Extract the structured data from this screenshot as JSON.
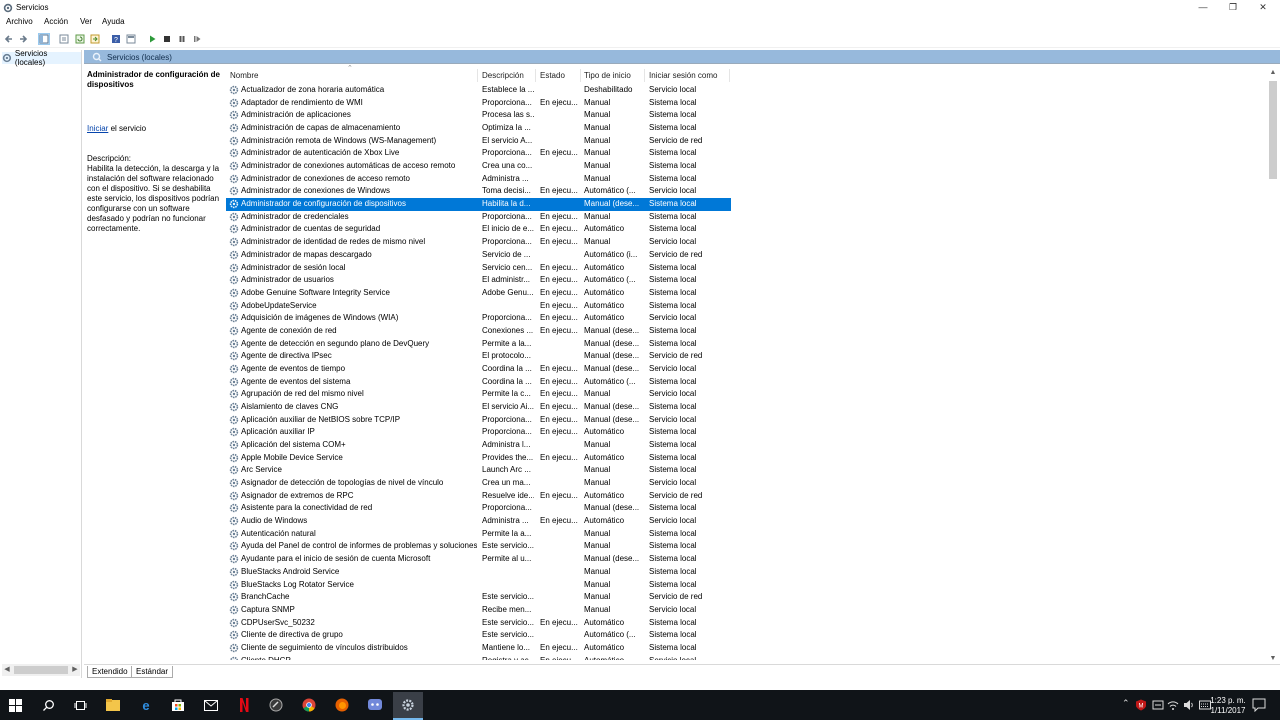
{
  "window": {
    "title": "Servicios",
    "minimize_glyph": "—",
    "restore_glyph": "❐",
    "close_glyph": "✕"
  },
  "menu": [
    "Archivo",
    "Acción",
    "Ver",
    "Ayuda"
  ],
  "tree": {
    "item": "Servicios (locales)"
  },
  "header": {
    "title": "Servicios (locales)"
  },
  "description": {
    "title": "Administrador de configuración de dispositivos",
    "link": "Iniciar",
    "link_suffix": " el servicio",
    "label": "Descripción:",
    "text": "Habilita la detección, la descarga y la instalación del software relacionado con el dispositivo. Si se deshabilita este servicio, los dispositivos podrían configurarse con un software desfasado y podrían no funcionar correctamente."
  },
  "columns": [
    "Nombre",
    "Descripción",
    "Estado",
    "Tipo de inicio",
    "Iniciar sesión como"
  ],
  "services": [
    {
      "name": "Actualizador de zona horaria automática",
      "desc": "Establece la ...",
      "state": "",
      "start": "Deshabilitado",
      "logon": "Servicio local"
    },
    {
      "name": "Adaptador de rendimiento de WMI",
      "desc": "Proporciona...",
      "state": "En ejecu...",
      "start": "Manual",
      "logon": "Sistema local"
    },
    {
      "name": "Administración de aplicaciones",
      "desc": "Procesa las s...",
      "state": "",
      "start": "Manual",
      "logon": "Sistema local"
    },
    {
      "name": "Administración de capas de almacenamiento",
      "desc": "Optimiza la ...",
      "state": "",
      "start": "Manual",
      "logon": "Sistema local"
    },
    {
      "name": "Administración remota de Windows (WS-Management)",
      "desc": "El servicio A...",
      "state": "",
      "start": "Manual",
      "logon": "Servicio de red"
    },
    {
      "name": "Administrador de autenticación de Xbox Live",
      "desc": "Proporciona...",
      "state": "En ejecu...",
      "start": "Manual",
      "logon": "Sistema local"
    },
    {
      "name": "Administrador de conexiones automáticas de acceso remoto",
      "desc": "Crea una co...",
      "state": "",
      "start": "Manual",
      "logon": "Sistema local"
    },
    {
      "name": "Administrador de conexiones de acceso remoto",
      "desc": "Administra ...",
      "state": "",
      "start": "Manual",
      "logon": "Sistema local"
    },
    {
      "name": "Administrador de conexiones de Windows",
      "desc": "Toma decisi...",
      "state": "En ejecu...",
      "start": "Automático (...",
      "logon": "Servicio local"
    },
    {
      "name": "Administrador de configuración de dispositivos",
      "desc": "Habilita la d...",
      "state": "",
      "start": "Manual (dese...",
      "logon": "Sistema local",
      "selected": true
    },
    {
      "name": "Administrador de credenciales",
      "desc": "Proporciona...",
      "state": "En ejecu...",
      "start": "Manual",
      "logon": "Sistema local"
    },
    {
      "name": "Administrador de cuentas de seguridad",
      "desc": "El inicio de e...",
      "state": "En ejecu...",
      "start": "Automático",
      "logon": "Sistema local"
    },
    {
      "name": "Administrador de identidad de redes de mismo nivel",
      "desc": "Proporciona...",
      "state": "En ejecu...",
      "start": "Manual",
      "logon": "Servicio local"
    },
    {
      "name": "Administrador de mapas descargado",
      "desc": "Servicio de ...",
      "state": "",
      "start": "Automático (i...",
      "logon": "Servicio de red"
    },
    {
      "name": "Administrador de sesión local",
      "desc": "Servicio cen...",
      "state": "En ejecu...",
      "start": "Automático",
      "logon": "Sistema local"
    },
    {
      "name": "Administrador de usuarios",
      "desc": "El administr...",
      "state": "En ejecu...",
      "start": "Automático (...",
      "logon": "Sistema local"
    },
    {
      "name": "Adobe Genuine Software Integrity Service",
      "desc": "Adobe Genu...",
      "state": "En ejecu...",
      "start": "Automático",
      "logon": "Sistema local"
    },
    {
      "name": "AdobeUpdateService",
      "desc": "",
      "state": "En ejecu...",
      "start": "Automático",
      "logon": "Sistema local"
    },
    {
      "name": "Adquisición de imágenes de Windows (WIA)",
      "desc": "Proporciona...",
      "state": "En ejecu...",
      "start": "Automático",
      "logon": "Servicio local"
    },
    {
      "name": "Agente de conexión de red",
      "desc": "Conexiones ...",
      "state": "En ejecu...",
      "start": "Manual (dese...",
      "logon": "Sistema local"
    },
    {
      "name": "Agente de detección en segundo plano de DevQuery",
      "desc": "Permite a la...",
      "state": "",
      "start": "Manual (dese...",
      "logon": "Sistema local"
    },
    {
      "name": "Agente de directiva IPsec",
      "desc": "El protocolo...",
      "state": "",
      "start": "Manual (dese...",
      "logon": "Servicio de red"
    },
    {
      "name": "Agente de eventos de tiempo",
      "desc": "Coordina la ...",
      "state": "En ejecu...",
      "start": "Manual (dese...",
      "logon": "Servicio local"
    },
    {
      "name": "Agente de eventos del sistema",
      "desc": "Coordina la ...",
      "state": "En ejecu...",
      "start": "Automático (...",
      "logon": "Sistema local"
    },
    {
      "name": "Agrupación de red del mismo nivel",
      "desc": "Permite la c...",
      "state": "En ejecu...",
      "start": "Manual",
      "logon": "Servicio local"
    },
    {
      "name": "Aislamiento de claves CNG",
      "desc": "El servicio Ai...",
      "state": "En ejecu...",
      "start": "Manual (dese...",
      "logon": "Sistema local"
    },
    {
      "name": "Aplicación auxiliar de NetBIOS sobre TCP/IP",
      "desc": "Proporciona...",
      "state": "En ejecu...",
      "start": "Manual (dese...",
      "logon": "Servicio local"
    },
    {
      "name": "Aplicación auxiliar IP",
      "desc": "Proporciona...",
      "state": "En ejecu...",
      "start": "Automático",
      "logon": "Sistema local"
    },
    {
      "name": "Aplicación del sistema COM+",
      "desc": "Administra l...",
      "state": "",
      "start": "Manual",
      "logon": "Sistema local"
    },
    {
      "name": "Apple Mobile Device Service",
      "desc": "Provides the...",
      "state": "En ejecu...",
      "start": "Automático",
      "logon": "Sistema local"
    },
    {
      "name": "Arc Service",
      "desc": " Launch Arc ...",
      "state": "",
      "start": "Manual",
      "logon": "Sistema local"
    },
    {
      "name": "Asignador de detección de topologías de nivel de vínculo",
      "desc": "Crea un ma...",
      "state": "",
      "start": "Manual",
      "logon": "Servicio local"
    },
    {
      "name": "Asignador de extremos de RPC",
      "desc": "Resuelve ide...",
      "state": "En ejecu...",
      "start": "Automático",
      "logon": "Servicio de red"
    },
    {
      "name": "Asistente para la conectividad de red",
      "desc": "Proporciona...",
      "state": "",
      "start": "Manual (dese...",
      "logon": "Sistema local"
    },
    {
      "name": "Audio de Windows",
      "desc": "Administra ...",
      "state": "En ejecu...",
      "start": "Automático",
      "logon": "Servicio local"
    },
    {
      "name": "Autenticación natural",
      "desc": "Permite la a...",
      "state": "",
      "start": "Manual",
      "logon": "Sistema local"
    },
    {
      "name": "Ayuda del Panel de control de informes de problemas y soluciones",
      "desc": "Este servicio...",
      "state": "",
      "start": "Manual",
      "logon": "Sistema local"
    },
    {
      "name": "Ayudante para el inicio de sesión de cuenta Microsoft",
      "desc": "Permite al u...",
      "state": "",
      "start": "Manual (dese...",
      "logon": "Sistema local"
    },
    {
      "name": "BlueStacks Android Service",
      "desc": "",
      "state": "",
      "start": "Manual",
      "logon": "Sistema local"
    },
    {
      "name": "BlueStacks Log Rotator Service",
      "desc": "",
      "state": "",
      "start": "Manual",
      "logon": "Sistema local"
    },
    {
      "name": "BranchCache",
      "desc": "Este servicio...",
      "state": "",
      "start": "Manual",
      "logon": "Servicio de red"
    },
    {
      "name": "Captura SNMP",
      "desc": "Recibe men...",
      "state": "",
      "start": "Manual",
      "logon": "Servicio local"
    },
    {
      "name": "CDPUserSvc_50232",
      "desc": "Este servicio...",
      "state": "En ejecu...",
      "start": "Automático",
      "logon": "Sistema local"
    },
    {
      "name": "Cliente de directiva de grupo",
      "desc": "Este servicio...",
      "state": "",
      "start": "Automático (...",
      "logon": "Sistema local"
    },
    {
      "name": "Cliente de seguimiento de vínculos distribuidos",
      "desc": "Mantiene lo...",
      "state": "En ejecu...",
      "start": "Automático",
      "logon": "Sistema local"
    },
    {
      "name": "Cliente DHCP",
      "desc": "Registra y ac...",
      "state": "En ejecu...",
      "start": "Automático",
      "logon": "Servicio local"
    }
  ],
  "tabs": [
    "Extendido",
    "Estándar"
  ],
  "clock": {
    "time": "1:23 p. m.",
    "date": "1/11/2017"
  },
  "tray": {
    "up_arrow": "⌃",
    "lang": ""
  }
}
